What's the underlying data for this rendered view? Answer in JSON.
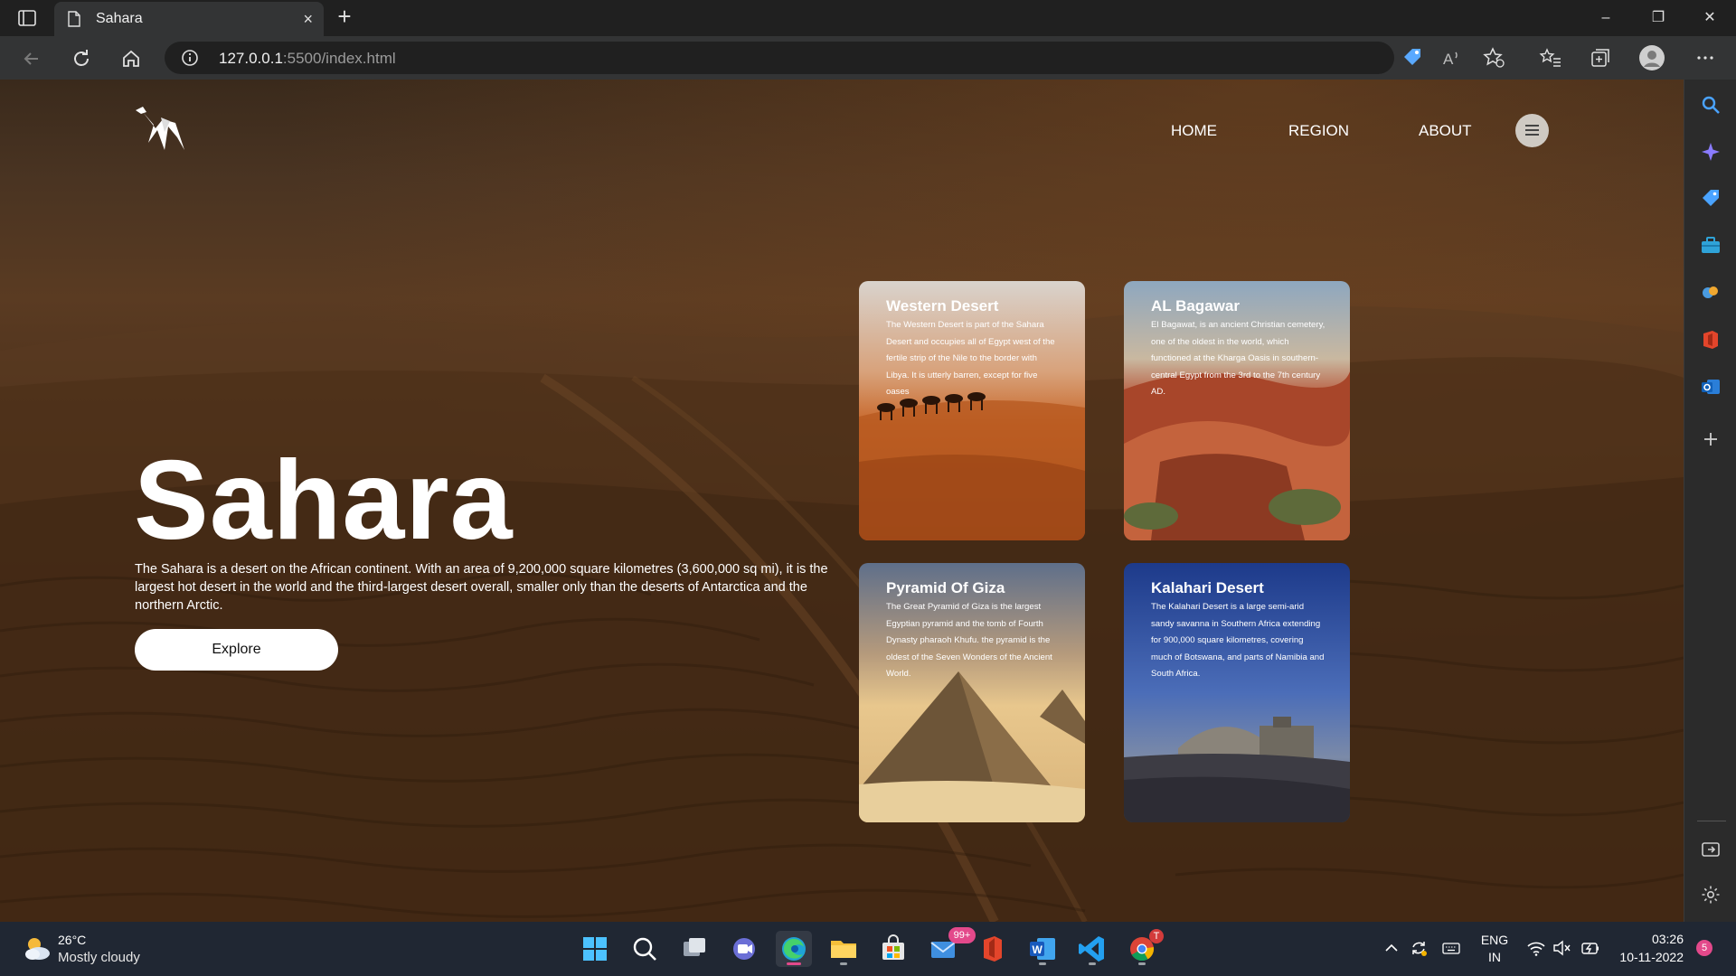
{
  "browser": {
    "tab_title": "Sahara",
    "tab_close": "×",
    "new_tab": "+",
    "url_host": "127.0.0.1",
    "url_path": ":5500/index.html",
    "window_controls": {
      "minimize": "–",
      "restore": "❐",
      "close": "✕"
    }
  },
  "site": {
    "nav": [
      "HOME",
      "REGION",
      "ABOUT"
    ],
    "hero": {
      "title": "Sahara",
      "description": "The Sahara is a desert on the African continent. With an area of 9,200,000 square kilometres (3,600,000 sq mi), it is the largest hot desert in the world and the third-largest desert overall, smaller only than the deserts of Antarctica and the northern Arctic.",
      "button": "Explore"
    },
    "cards": [
      {
        "title": "Western Desert",
        "text": "The Western Desert is part of the Sahara Desert and occupies all of Egypt west of the fertile strip of the Nile to the border with Libya. It is utterly barren, except for five oases"
      },
      {
        "title": "AL Bagawar",
        "text": "El Bagawat, is an ancient Christian cemetery, one of the oldest in the world, which functioned at the Kharga Oasis in southern-central Egypt from the 3rd to the 7th century AD."
      },
      {
        "title": "Pyramid Of Giza",
        "text": "The Great Pyramid of Giza is the largest Egyptian pyramid and the tomb of Fourth Dynasty pharaoh Khufu. the pyramid is the oldest of the Seven Wonders of the Ancient World."
      },
      {
        "title": "Kalahari Desert",
        "text": "The Kalahari Desert is a large semi-arid sandy savanna in Southern Africa extending for 900,000 square kilometres, covering much of Botswana, and parts of Namibia and South Africa."
      }
    ]
  },
  "taskbar": {
    "weather_temp": "26°C",
    "weather_desc": "Mostly cloudy",
    "mail_badge": "99+",
    "chrome_badge": "T",
    "lang_top": "ENG",
    "lang_bottom": "IN",
    "time": "03:26",
    "date": "10-11-2022",
    "notification_count": "5"
  },
  "colors": {
    "accent_pink": "#e3498b",
    "chrome_dark": "#202020",
    "chrome_mid": "#333435",
    "taskbar": "#202733"
  }
}
